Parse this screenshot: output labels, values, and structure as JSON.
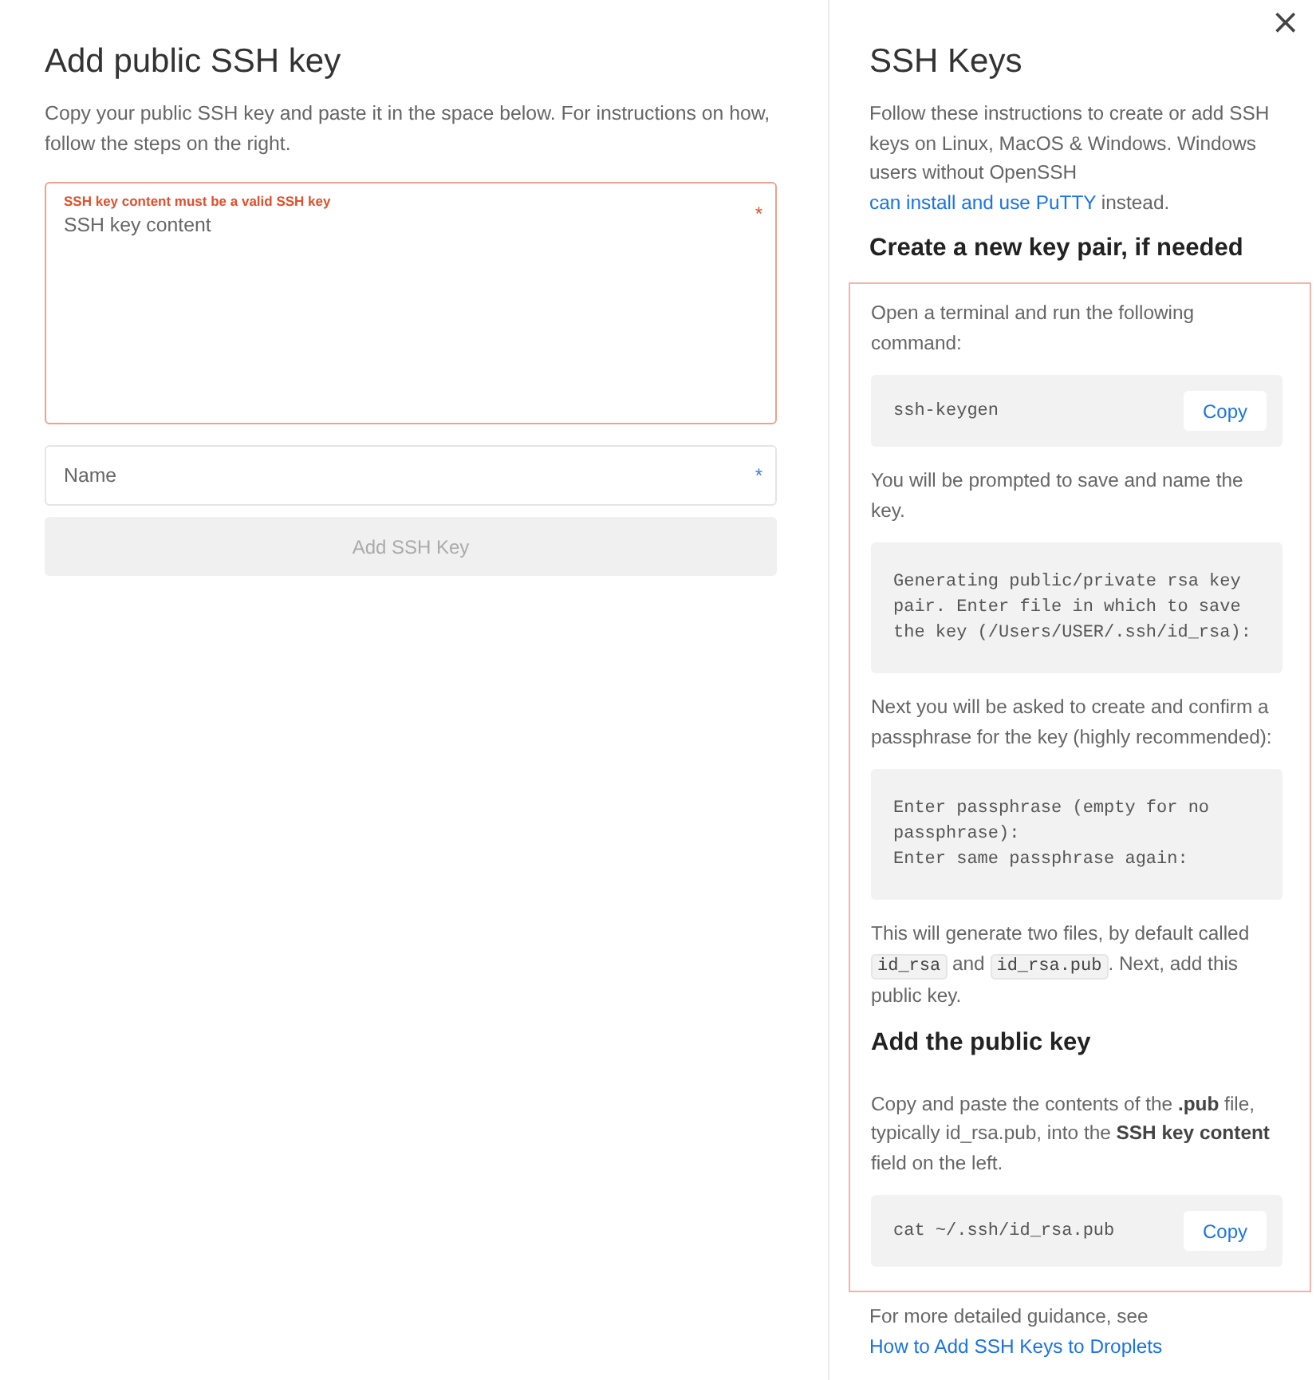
{
  "form": {
    "title": "Add public SSH key",
    "description": "Copy your public SSH key and paste it in the space below. For instructions on how, follow the steps on the right.",
    "key_field": {
      "error": "SSH key content must be a valid SSH key",
      "placeholder": "SSH key content",
      "required_mark": "*",
      "invalid": true
    },
    "name_field": {
      "placeholder": "Name",
      "required_mark": "*",
      "invalid": false
    },
    "submit": {
      "label": "Add SSH Key",
      "disabled": true
    }
  },
  "help": {
    "close": "×",
    "title": "SSH Keys",
    "intro": [
      {
        "kind": "text",
        "text": "Follow these instructions to create or add SSH keys on Linux, MacOS & Windows. Windows users without OpenSSH "
      },
      {
        "kind": "link",
        "text": "can install and use PuTTY"
      },
      {
        "kind": "text",
        "text": " instead."
      }
    ],
    "section_heading": "Create a new key pair, if needed",
    "steps": [
      {
        "kind": "paragraph",
        "parts": [
          {
            "kind": "text",
            "text": "Open a terminal and run the following command:"
          }
        ]
      },
      {
        "kind": "code",
        "lines": [
          "ssh-keygen"
        ],
        "copy": "Copy"
      },
      {
        "kind": "paragraph",
        "parts": [
          {
            "kind": "text",
            "text": "You will be prompted to save and name the key."
          }
        ]
      },
      {
        "kind": "code",
        "lines": [
          "Generating public/private rsa key pair. Enter file in which to save the key (/Users/USER/.ssh/id_rsa):"
        ]
      },
      {
        "kind": "paragraph",
        "parts": [
          {
            "kind": "text",
            "text": "Next you will be asked to create and confirm a passphrase for the key (highly recommended):"
          }
        ]
      },
      {
        "kind": "code",
        "lines": [
          "Enter passphrase (empty for no passphrase):",
          "Enter same passphrase again:"
        ]
      },
      {
        "kind": "paragraph",
        "parts": [
          {
            "kind": "text",
            "text": "This will generate two files, by default called "
          },
          {
            "kind": "code",
            "text": "id_rsa"
          },
          {
            "kind": "text",
            "text": " and "
          },
          {
            "kind": "code",
            "text": "id_rsa.pub"
          },
          {
            "kind": "text",
            "text": ". Next, add this public key."
          }
        ]
      },
      {
        "kind": "heading",
        "text": "Add the public key"
      },
      {
        "kind": "paragraph",
        "parts": [
          {
            "kind": "text",
            "text": "Copy and paste the contents of the **.pub** file, typically id_rsa.pub, into the **SSH key content** field on the left."
          }
        ]
      },
      {
        "kind": "code",
        "lines": [
          "cat ~/.ssh/id_rsa.pub"
        ],
        "copy": "Copy"
      }
    ],
    "footer": [
      {
        "kind": "text",
        "text": "For more detailed guidance, see "
      },
      {
        "kind": "link",
        "text": "How to Add SSH Keys to Droplets"
      }
    ]
  }
}
